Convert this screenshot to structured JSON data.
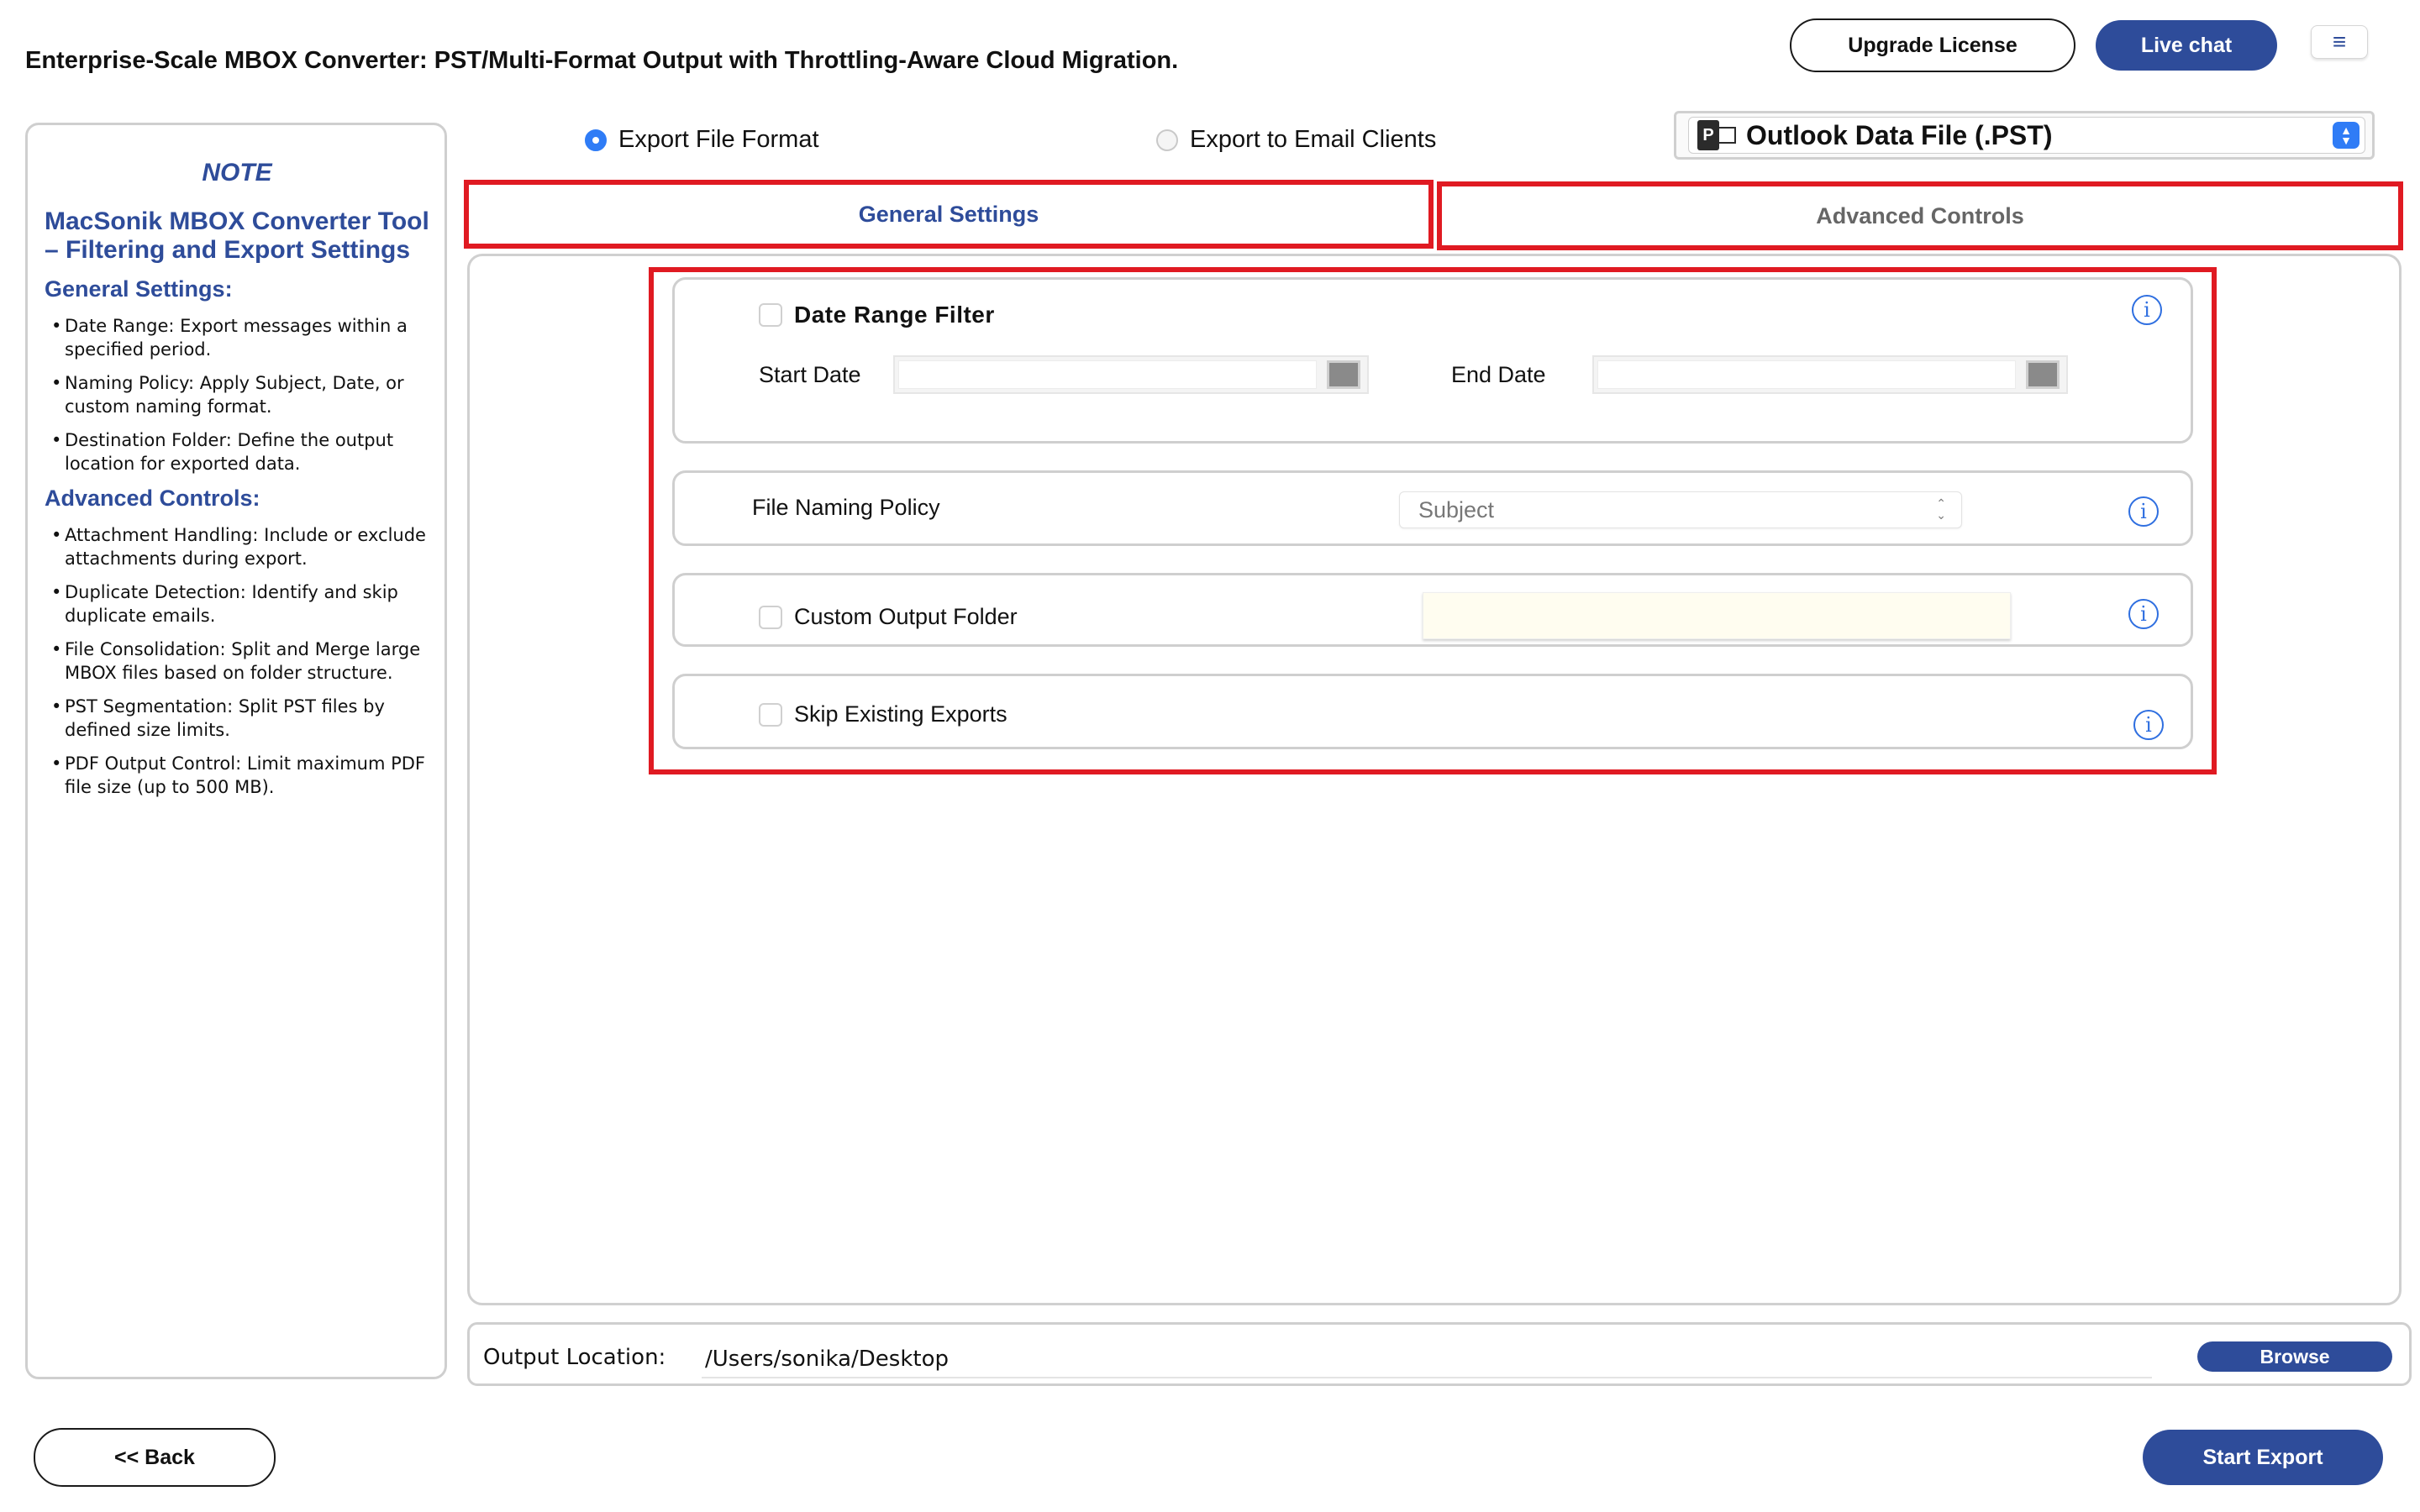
{
  "header": {
    "title": "Enterprise-Scale MBOX Converter: PST/Multi-Format Output with Throttling-Aware Cloud Migration.",
    "upgrade_label": "Upgrade License",
    "live_chat_label": "Live chat",
    "menu_glyph": "≡"
  },
  "note": {
    "title": "NOTE",
    "heading": "MacSonik MBOX Converter Tool – Filtering and Export Settings",
    "general_heading": "General Settings:",
    "general_items": [
      "Date Range: Export messages within a specified period.",
      "Naming Policy: Apply Subject, Date, or custom naming format.",
      "Destination Folder: Define the output location for exported data."
    ],
    "advanced_heading": "Advanced Controls:",
    "advanced_items": [
      "Attachment Handling: Include or exclude attachments during export.",
      "Duplicate Detection: Identify and skip duplicate emails.",
      "File Consolidation: Split and Merge large MBOX files based on folder structure.",
      "PST Segmentation: Split PST files by defined size limits.",
      "PDF Output Control: Limit maximum PDF file size (up to 500 MB)."
    ]
  },
  "export_mode": {
    "file_format_label": "Export File Format",
    "email_clients_label": "Export to Email Clients",
    "selected": "Export File Format"
  },
  "format_select": {
    "icon_letter": "P",
    "selected": "Outlook Data File (.PST)"
  },
  "tabs": {
    "general": "General Settings",
    "advanced": "Advanced Controls",
    "active": "General Settings"
  },
  "settings": {
    "date_range": {
      "label": "Date Range Filter",
      "checked": false,
      "start_label": "Start Date",
      "start_value": "",
      "end_label": "End Date",
      "end_value": ""
    },
    "naming": {
      "label": "File Naming Policy",
      "value": "Subject"
    },
    "custom_folder": {
      "label": "Custom Output Folder",
      "checked": false,
      "value": ""
    },
    "skip_existing": {
      "label": "Skip Existing Exports",
      "checked": false
    },
    "info_glyph": "i"
  },
  "output": {
    "label": "Output Location:",
    "path": "/Users/sonika/Desktop",
    "browse_label": "Browse"
  },
  "footer": {
    "back_label": "<<  Back",
    "start_label": "Start Export"
  },
  "colors": {
    "brand_blue": "#2e4c9a",
    "highlight_red": "#e01a22",
    "accent_blue": "#2f7cf6"
  }
}
